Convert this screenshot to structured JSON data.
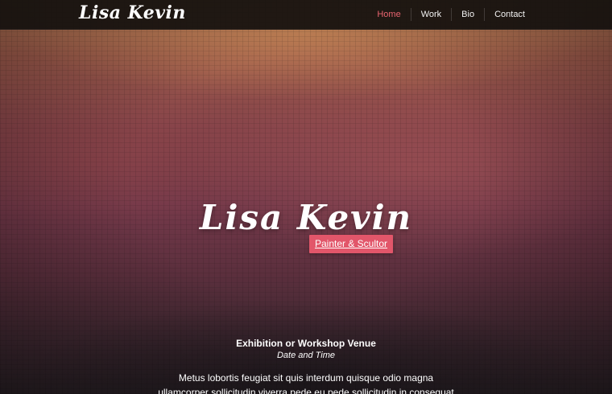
{
  "nav": {
    "brand": "Lisa Kevin",
    "items": [
      {
        "label": "Home",
        "active": true
      },
      {
        "label": "Work",
        "active": false
      },
      {
        "label": "Bio",
        "active": false
      },
      {
        "label": "Contact",
        "active": false
      }
    ],
    "active_color": "#e8646f"
  },
  "hero": {
    "title": "Lisa Kevin",
    "subtitle": "Painter & Scultor",
    "badge_color": "#e2566a"
  },
  "event": {
    "venue": "Exhibition or Workshop Venue",
    "datetime": "Date and Time",
    "description_line1": "Metus lobortis feugiat sit quis interdum quisque odio magna",
    "description_line2": "ullamcorper sollicitudin viverra pede eu pede sollicitudin in consequat"
  }
}
